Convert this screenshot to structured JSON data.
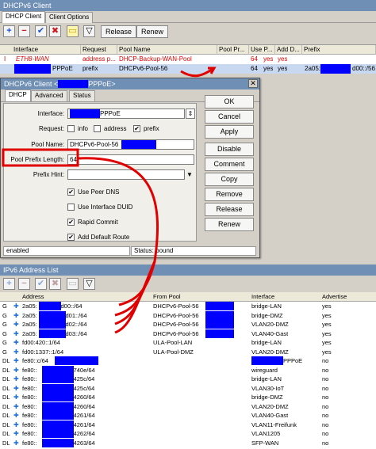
{
  "client_window": {
    "title": "DHCPv6 Client",
    "tabs": [
      "DHCP Client",
      "Client Options"
    ],
    "toolbar": {
      "add": "+",
      "remove": "−",
      "enable": "✔",
      "disable": "✖",
      "comment": "▭",
      "filter": "▽",
      "release": "Release",
      "renew": "Renew"
    },
    "columns": [
      "Interface",
      "Request",
      "Pool Name",
      "Pool Pr...",
      "Use P...",
      "Add D...",
      "Prefix"
    ],
    "rows": [
      {
        "flag": "I",
        "interface": "ETH8-WAN",
        "request": "address p...",
        "pool": "DHCP-Backup-WAN-Pool",
        "pool_prefix": "64",
        "use_peer": "yes",
        "add_default": "yes",
        "prefix": ""
      },
      {
        "flag": "",
        "interface": "PPPoE",
        "request": "prefix",
        "pool": "DHCPv6-Pool-56",
        "pool_prefix": "64",
        "use_peer": "yes",
        "add_default": "yes",
        "prefix_start": "2a05:",
        "prefix_end": "d00::/56"
      }
    ]
  },
  "dialog": {
    "title_prefix": "DHCPv6 Client <",
    "title_suffix": "PPPoE>",
    "tabs": [
      "DHCP",
      "Advanced",
      "Status"
    ],
    "labels": {
      "interface": "Interface:",
      "request": "Request:",
      "pool_name": "Pool Name:",
      "pool_prefix_length": "Pool Prefix Length:",
      "prefix_hint": "Prefix Hint:"
    },
    "values": {
      "interface": "PPPoE",
      "pool_name": "DHCPv6-Pool-56",
      "pool_prefix_length": "64"
    },
    "request_opts": {
      "info": "info",
      "address": "address",
      "prefix": "prefix"
    },
    "checks": {
      "use_peer_dns": "Use Peer DNS",
      "use_interface_duid": "Use Interface DUID",
      "rapid_commit": "Rapid Commit",
      "add_default_route": "Add Default Route"
    },
    "buttons": [
      "OK",
      "Cancel",
      "Apply",
      "Disable",
      "Comment",
      "Copy",
      "Remove",
      "Release",
      "Renew"
    ],
    "status_left": "enabled",
    "status_right": "Status: bound"
  },
  "addr_window": {
    "title": "IPv6 Address List",
    "columns": [
      "Address",
      "From Pool",
      "Interface",
      "Advertise"
    ],
    "rows": [
      {
        "flag": "G",
        "addr_a": "2a05:",
        "addr_b": "d00::/64",
        "pool": "DHCPv6-Pool-56",
        "iface": "bridge-LAN",
        "adv": "yes"
      },
      {
        "flag": "G",
        "addr_a": "2a05:",
        "addr_b": "d01::/64",
        "pool": "DHCPv6-Pool-56",
        "iface": "bridge-DMZ",
        "adv": "yes"
      },
      {
        "flag": "G",
        "addr_a": "2a05:",
        "addr_b": "d02::/64",
        "pool": "DHCPv6-Pool-56",
        "iface": "VLAN20-DMZ",
        "adv": "yes"
      },
      {
        "flag": "G",
        "addr_a": "2a05:",
        "addr_b": "d03::/64",
        "pool": "DHCPv6-Pool-56",
        "iface": "VLAN40-Gast",
        "adv": "yes"
      },
      {
        "flag": "G",
        "addr_a": "fd00:420::1/64",
        "addr_b": "",
        "pool": "ULA-Pool-LAN",
        "iface": "bridge-LAN",
        "adv": "yes"
      },
      {
        "flag": "G",
        "addr_a": "fd00:1337::1/64",
        "addr_b": "",
        "pool": "ULA-Pool-DMZ",
        "iface": "VLAN20-DMZ",
        "adv": "yes"
      },
      {
        "flag": "DL",
        "addr_a": "fe80::c/64",
        "addr_b": "",
        "pool": "",
        "iface": "PPPoE",
        "adv": "no"
      },
      {
        "flag": "DL",
        "addr_a": "fe80::",
        "addr_b": "740e/64",
        "pool": "",
        "iface": "wireguard",
        "adv": "no"
      },
      {
        "flag": "DL",
        "addr_a": "fe80::",
        "addr_b": "425c/64",
        "pool": "",
        "iface": "bridge-LAN",
        "adv": "no"
      },
      {
        "flag": "DL",
        "addr_a": "fe80::",
        "addr_b": "425c/64",
        "pool": "",
        "iface": "VLAN30-IoT",
        "adv": "no"
      },
      {
        "flag": "DL",
        "addr_a": "fe80::",
        "addr_b": "4260/64",
        "pool": "",
        "iface": "bridge-DMZ",
        "adv": "no"
      },
      {
        "flag": "DL",
        "addr_a": "fe80::",
        "addr_b": "4260/64",
        "pool": "",
        "iface": "VLAN20-DMZ",
        "adv": "no"
      },
      {
        "flag": "DL",
        "addr_a": "fe80::",
        "addr_b": "4261/64",
        "pool": "",
        "iface": "VLAN40-Gast",
        "adv": "no"
      },
      {
        "flag": "DL",
        "addr_a": "fe80::",
        "addr_b": "4261/64",
        "pool": "",
        "iface": "VLAN11-Freifunk",
        "adv": "no"
      },
      {
        "flag": "DL",
        "addr_a": "fe80::",
        "addr_b": "4262/64",
        "pool": "",
        "iface": "VLAN1205",
        "adv": "no"
      },
      {
        "flag": "DL",
        "addr_a": "fe80::",
        "addr_b": "4263/64",
        "pool": "",
        "iface": "SFP-WAN",
        "adv": "no"
      }
    ]
  },
  "colors": {
    "title_bar": "#6f8fb5",
    "redaction": "#0000ff",
    "annotation": "#e00000"
  }
}
